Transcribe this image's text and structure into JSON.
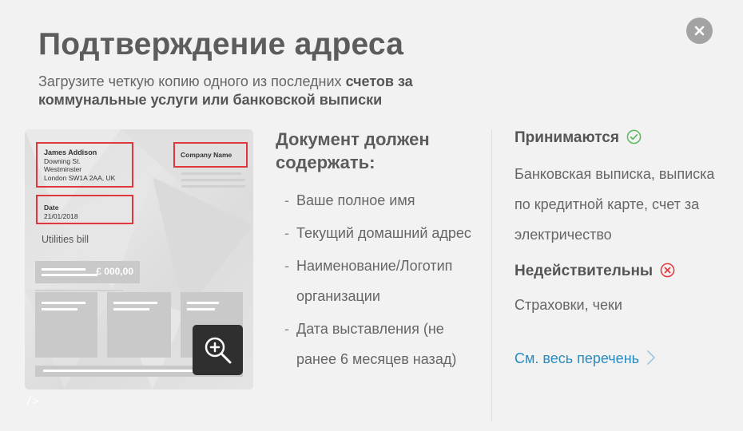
{
  "modal": {
    "title": "Подтверждение адреса",
    "subtitle_prefix": "Загрузите четкую копию одного из последних ",
    "subtitle_bold": "счетов за коммунальные услуги или банковской выписки",
    "close_icon": "close-icon"
  },
  "bill_preview": {
    "sender_name": "James Addison",
    "sender_line1": "Downing St.",
    "sender_line2": "Westminster",
    "sender_line3": "London SW1A 2AA, UK",
    "company": "Company Name",
    "date_label": "Date",
    "date_value": "21/01/2018",
    "doc_type": "Utilities bill",
    "amount": "£ 000,00",
    "highlight_color": "#e0373e",
    "zoom_icon": "zoom-in-icon"
  },
  "requirements": {
    "heading": "Документ должен содержать:",
    "items": [
      "Ваше полное имя",
      "Текущий домашний адрес",
      "Наименование/Логотип организации",
      "Дата выставления (не ранее 6 месяцев назад)"
    ]
  },
  "accepted": {
    "heading": "Принимаются",
    "text": "Банковская выписка, выписка по кредитной карте, счет за электричество",
    "icon": "check-circle-icon",
    "icon_color": "#5cb85c"
  },
  "invalid": {
    "heading": "Недействительны",
    "text": "Страховки, чеки",
    "icon": "x-circle-icon",
    "icon_color": "#e0373e"
  },
  "see_all": {
    "label": "См. весь перечень",
    "color": "#2a8bbf"
  }
}
